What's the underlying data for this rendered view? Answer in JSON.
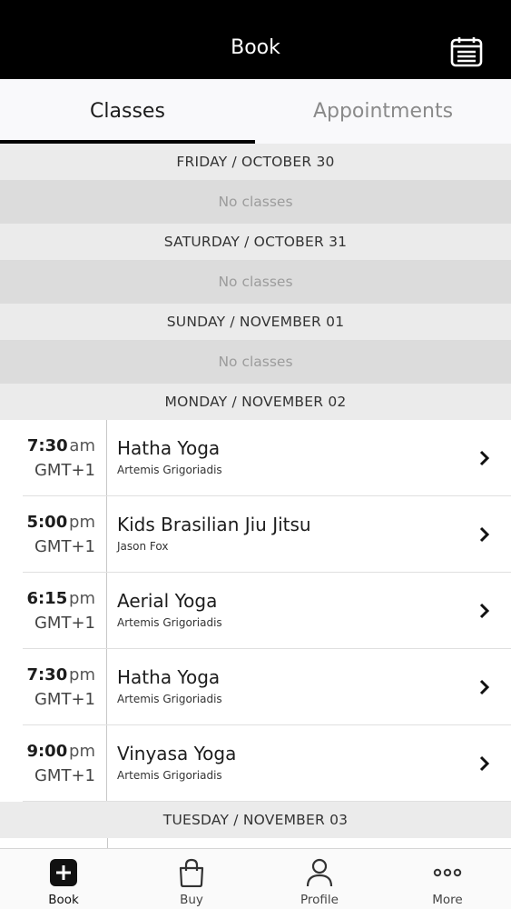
{
  "header": {
    "title": "Book",
    "calendar_icon": "calendar-list-icon"
  },
  "tabs": [
    {
      "label": "Classes",
      "active": true
    },
    {
      "label": "Appointments",
      "active": false
    }
  ],
  "days": [
    {
      "header": "FRIDAY / OCTOBER 30",
      "empty_text": "No classes"
    },
    {
      "header": "SATURDAY / OCTOBER 31",
      "empty_text": "No classes"
    },
    {
      "header": "SUNDAY / NOVEMBER 01",
      "empty_text": "No classes"
    },
    {
      "header": "MONDAY / NOVEMBER 02",
      "classes": [
        {
          "time": "7:30",
          "ampm": "am",
          "tz": "GMT+1",
          "name": "Hatha Yoga",
          "instructor": "Artemis Grigoriadis"
        },
        {
          "time": "5:00",
          "ampm": "pm",
          "tz": "GMT+1",
          "name": "Kids Brasilian Jiu Jitsu",
          "instructor": "Jason Fox"
        },
        {
          "time": "6:15",
          "ampm": "pm",
          "tz": "GMT+1",
          "name": "Aerial Yoga",
          "instructor": "Artemis Grigoriadis"
        },
        {
          "time": "7:30",
          "ampm": "pm",
          "tz": "GMT+1",
          "name": "Hatha Yoga",
          "instructor": "Artemis Grigoriadis"
        },
        {
          "time": "9:00",
          "ampm": "pm",
          "tz": "GMT+1",
          "name": "Vinyasa Yoga",
          "instructor": "Artemis Grigoriadis"
        }
      ]
    },
    {
      "header": "TUESDAY / NOVEMBER 03"
    }
  ],
  "tabbar": [
    {
      "label": "Book",
      "icon": "plus-square-icon",
      "active": true
    },
    {
      "label": "Buy",
      "icon": "shopping-bag-icon",
      "active": false
    },
    {
      "label": "Profile",
      "icon": "person-icon",
      "active": false
    },
    {
      "label": "More",
      "icon": "more-dots-icon",
      "active": false
    }
  ]
}
